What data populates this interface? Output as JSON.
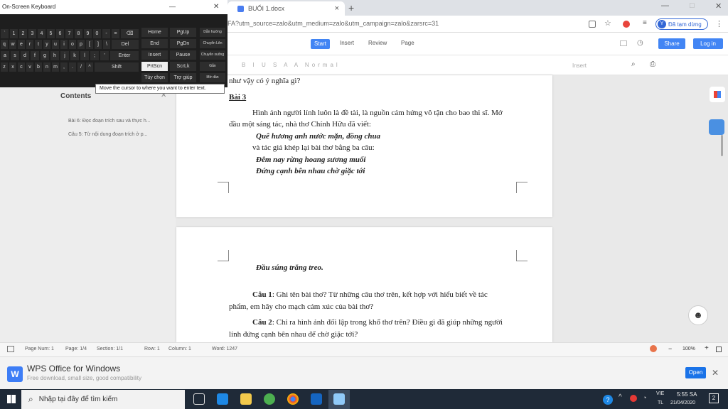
{
  "browser": {
    "tab_title": "BUỔI 1.docx",
    "tab_close": "×",
    "new_tab": "+",
    "url": "FA?utm_source=zalo&utm_medium=zalo&utm_campaign=zalo&zarsrc=31",
    "profile_initial": "Y",
    "profile_label": "Đã tạm dừng",
    "win_min": "—",
    "win_max": "□",
    "win_close": "✕"
  },
  "menu": {
    "start": "Start",
    "insert": "Insert",
    "review": "Review",
    "page": "Page",
    "share": "Share",
    "login": "Log in"
  },
  "format_bar": {
    "items": "B I U S A A Normal",
    "insert": "Insert"
  },
  "sidebar": {
    "title": "Contents",
    "items": [
      "Bài 6: Đọc đoạn trích sau và thực h...",
      "Câu 5: Từ nội dung đoạn trích ở p..."
    ]
  },
  "page1": {
    "line0": "như vậy có ý nghĩa gì?",
    "heading": "Bài 3",
    "p1": "Hình ảnh người lính luôn là đề tài, là nguồn cảm hứng vô tận cho bao thi sĩ. Mở",
    "p2": "đầu một sáng tác, nhà thơ Chính Hữu đã viết:",
    "v1": "Quê hương anh nước mặn, đồng chua",
    "p3": "và tác giả khép lại bài thơ bằng ba câu:",
    "v2": "Đêm nay rừng hoang sương muối",
    "v3": "Đứng cạnh bên nhau chờ giặc tới"
  },
  "page2": {
    "v4": "Đầu súng trăng treo.",
    "q1_label": "Câu 1",
    "q1a": ": Ghi tên bài thơ? Từ những câu thơ trên, kết hợp với hiểu biết về tác",
    "q1b": "phẩm, em hãy cho mạch cảm xúc của bài thơ?",
    "q2_label": "Câu 2",
    "q2a": ": Chỉ ra hình ảnh đối lập trong khổ thơ trên? Điều gì đã giúp những người",
    "q2b": "lính đứng cạnh bên nhau để chờ giặc tới?"
  },
  "status": {
    "page_num": "Page Num: 1",
    "page": "Page: 1/4",
    "section": "Section: 1/1",
    "row": "Row: 1",
    "column": "Column: 1",
    "word": "Word: 1247",
    "zoom": "100%",
    "zoom_minus": "−",
    "zoom_plus": "+"
  },
  "wps": {
    "title": "WPS Office for Windows",
    "subtitle": "Free download, small size, good compatibility",
    "open": "Open",
    "logo": "W",
    "close": "✕"
  },
  "taskbar": {
    "search": "Nhập tại đây để tìm kiếm",
    "lang1": "VIE",
    "lang2": "TL",
    "time": "5:55 SA",
    "date": "21/04/2020",
    "notif": "2"
  },
  "osk": {
    "title": "On-Screen Keyboard",
    "tooltip": "Move the cursor to where you want to enter text.",
    "row1": [
      "`",
      "1",
      "2",
      "3",
      "4",
      "5",
      "6",
      "7",
      "8",
      "9",
      "0",
      "-",
      "=",
      "⌫"
    ],
    "row2": [
      "q",
      "w",
      "e",
      "r",
      "t",
      "y",
      "u",
      "i",
      "o",
      "p",
      "[",
      "]",
      "\\",
      "Del"
    ],
    "row3": [
      "a",
      "s",
      "d",
      "f",
      "g",
      "h",
      "j",
      "k",
      "l",
      ";",
      "'",
      "Enter"
    ],
    "row4": [
      "z",
      "x",
      "c",
      "v",
      "b",
      "n",
      "m",
      ",",
      ".",
      "/",
      "^",
      "Shift"
    ],
    "right_col1": [
      "Home",
      "End",
      "Insert",
      "PrtScn",
      "Tùy chọn"
    ],
    "right_col2": [
      "PgUp",
      "PgDn",
      "Pause",
      "ScrLk",
      "Trợ giúp"
    ],
    "right_col3": [
      "Dẫn hướng",
      "Chuyển Lên",
      "Chuyển xuống",
      "Gắn",
      "Mờ dần"
    ],
    "min": "—",
    "close": "✕"
  }
}
